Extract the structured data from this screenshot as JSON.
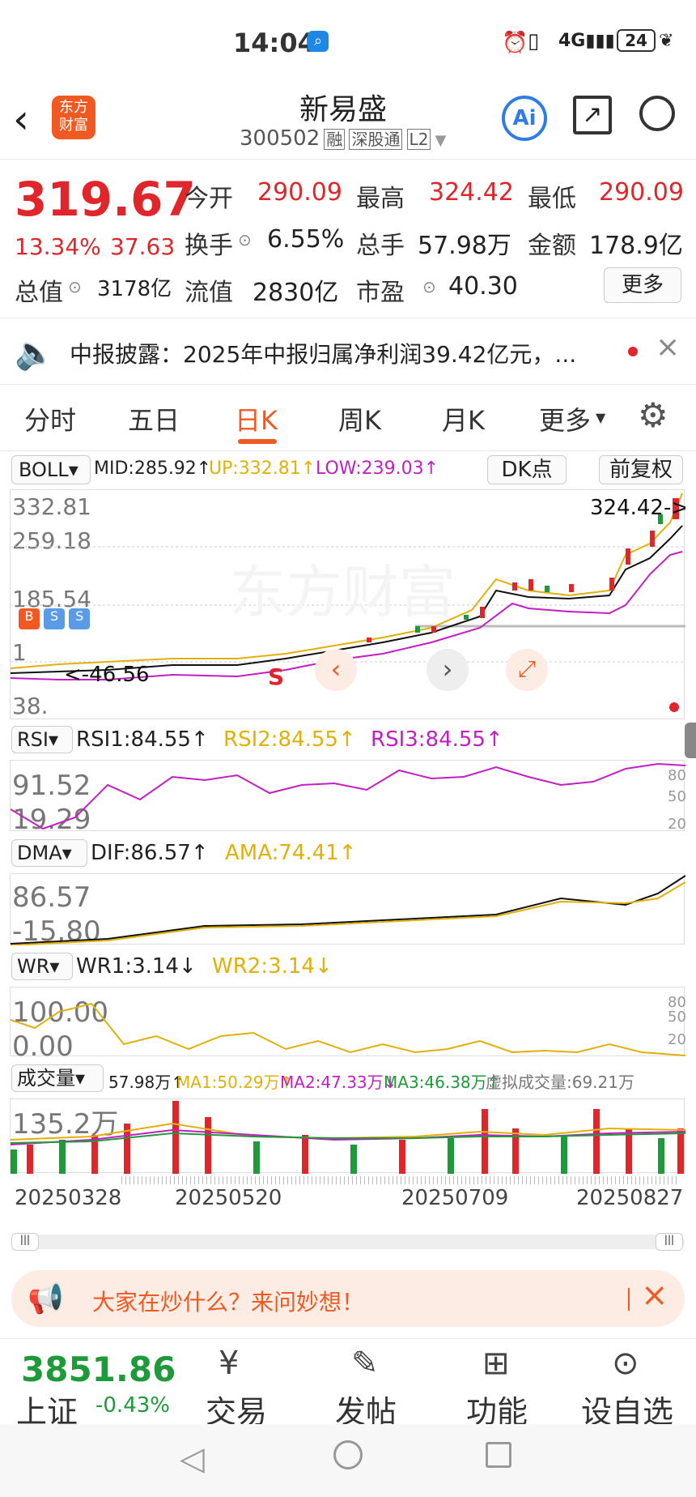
{
  "status_bar": {
    "time": "14:04",
    "battery": "24"
  },
  "header": {
    "title": "新易盛",
    "code": "300502",
    "tags": [
      "融",
      "深股通",
      "L2"
    ],
    "brand_logo_text": "东方\n财富",
    "ai_label": "Ai"
  },
  "quote": {
    "price": "319.67",
    "change_pct": "13.34%",
    "change": "37.63",
    "fields": [
      {
        "label": "今开",
        "value": "290.09"
      },
      {
        "label": "最高",
        "value": "324.42"
      },
      {
        "label": "最低",
        "value": "290.09"
      },
      {
        "label": "换手",
        "value": "6.55%"
      },
      {
        "label": "总手",
        "value": "57.98万"
      },
      {
        "label": "金额",
        "value": "178.9亿"
      },
      {
        "label": "总值",
        "value": "3178亿"
      },
      {
        "label": "流值",
        "value": "2830亿"
      },
      {
        "label": "市盈",
        "value": "40.30"
      }
    ],
    "more_label": "更多"
  },
  "notice": {
    "text": "中报披露：2025年中报归属净利润39.42亿元，..."
  },
  "period_tabs": {
    "items": [
      "分时",
      "五日",
      "日K",
      "周K",
      "月K",
      "更多"
    ],
    "active": "日K"
  },
  "boll": {
    "name": "BOLL",
    "mid": "MID:285.92↑",
    "up": "UP:332.81↑",
    "low": "LOW:239.03↑",
    "dk": "DK点",
    "fq": "前复权",
    "axis": [
      "332.81",
      "259.18",
      "185.54",
      "1",
      "38."
    ],
    "high_mark": "324.42->",
    "low_mark": "<-46.56",
    "s_mark": "S"
  },
  "rsi": {
    "name": "RSI",
    "rsi1": "RSI1:84.55↑",
    "rsi2": "RSI2:84.55↑",
    "rsi3": "RSI3:84.55↑",
    "axis": [
      "91.52",
      "19.29"
    ],
    "levels": [
      "80",
      "50",
      "20"
    ]
  },
  "dma": {
    "name": "DMA",
    "dif": "DIF:86.57↑",
    "ama": "AMA:74.41↑",
    "axis": [
      "86.57",
      "-15.80"
    ]
  },
  "wr": {
    "name": "WR",
    "wr1": "WR1:3.14↓",
    "wr2": "WR2:3.14↓",
    "axis": [
      "100.00",
      "0.00"
    ],
    "levels": [
      "80",
      "50",
      "20"
    ]
  },
  "volume": {
    "name": "成交量",
    "v": "57.98万↑",
    "ma1": "MA1:50.29万↑",
    "ma2": "MA2:47.33万↓",
    "ma3": "MA3:46.38万↑",
    "virtual": "虚拟成交量:69.21万",
    "axis": "135.2万"
  },
  "dates": [
    "20250328",
    "20250520",
    "20250709",
    "20250827"
  ],
  "banner": {
    "text": "大家在炒什么？来问妙想！"
  },
  "bottom_nav": {
    "index_value": "3851.86",
    "index_name": "上证",
    "index_change": "-0.43%",
    "items": [
      "交易",
      "发帖",
      "功能",
      "设自选"
    ]
  },
  "colors": {
    "up": "#e0262b",
    "down": "#1f9a3a",
    "ma_gold": "#e2b00a",
    "magenta": "#c31fc3",
    "accent": "#f05a22"
  }
}
